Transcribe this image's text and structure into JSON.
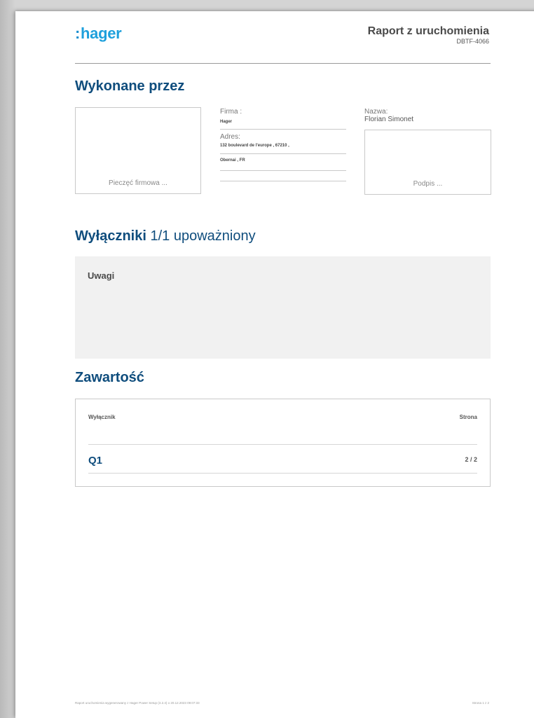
{
  "header": {
    "logo_dots": ":",
    "logo_text": "hager",
    "report_title": "Raport z uruchomienia",
    "report_code": "DBTF-4066"
  },
  "performed_by": {
    "title": "Wykonane przez",
    "stamp_label": "Pieczęć firmowa ...",
    "company_label": "Firma :",
    "company_value": "Hager",
    "address_label": "Adres:",
    "address_line1": "132 boulevard de l'europe , 67210 ,",
    "address_line2": "Obernai , FR",
    "name_label": "Nazwa:",
    "name_value": "Florian Simonet",
    "signature_label": "Podpis ..."
  },
  "breakers": {
    "title_bold": "Wyłączniki",
    "title_light": "1/1 upoważniony"
  },
  "notes": {
    "title": "Uwagi"
  },
  "contents": {
    "title": "Zawartość",
    "col_breaker": "Wyłącznik",
    "col_page": "Strona",
    "rows": [
      {
        "name": "Q1",
        "page": "2 / 2"
      }
    ]
  },
  "footer": {
    "left": "Raport uruchomienia wygenerowany z Hager Power Setup (3.2.4) o 20.12.2023 09:07:33",
    "right": "Strona 1 z 2"
  }
}
